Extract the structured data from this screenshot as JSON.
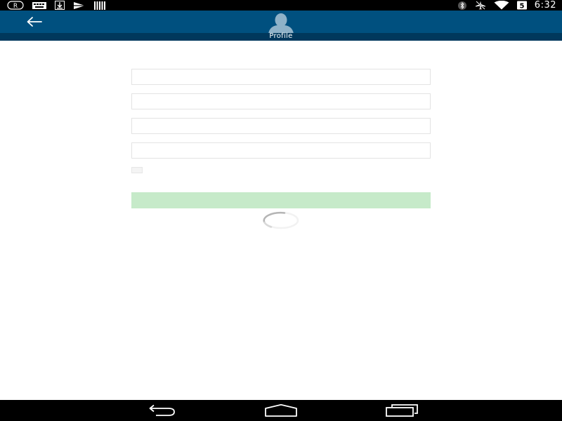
{
  "status_bar": {
    "left_icons": [
      "registered-icon",
      "keyboard-icon",
      "download-icon",
      "play-store-icon",
      "barcode-icon"
    ],
    "right_icons": [
      "bluetooth-icon",
      "airplane-mode-icon",
      "wifi-icon",
      "battery-icon"
    ],
    "time": "6:32"
  },
  "header": {
    "back_icon": "arrow-left-icon",
    "avatar_icon": "person-silhouette-icon",
    "title": "Profile",
    "background_color": "#00507f",
    "strip_color": "#00385c"
  },
  "form": {
    "fields": [
      {
        "value": "",
        "placeholder": ""
      },
      {
        "value": "",
        "placeholder": ""
      },
      {
        "value": "",
        "placeholder": ""
      },
      {
        "value": "",
        "placeholder": ""
      }
    ],
    "checkbox_checked": false,
    "checkbox_label": "",
    "submit_label": "",
    "submit_color": "#c6eac9",
    "loading": true
  },
  "nav_bar": {
    "buttons": [
      "back-nav-icon",
      "home-nav-icon",
      "recent-apps-icon"
    ]
  }
}
